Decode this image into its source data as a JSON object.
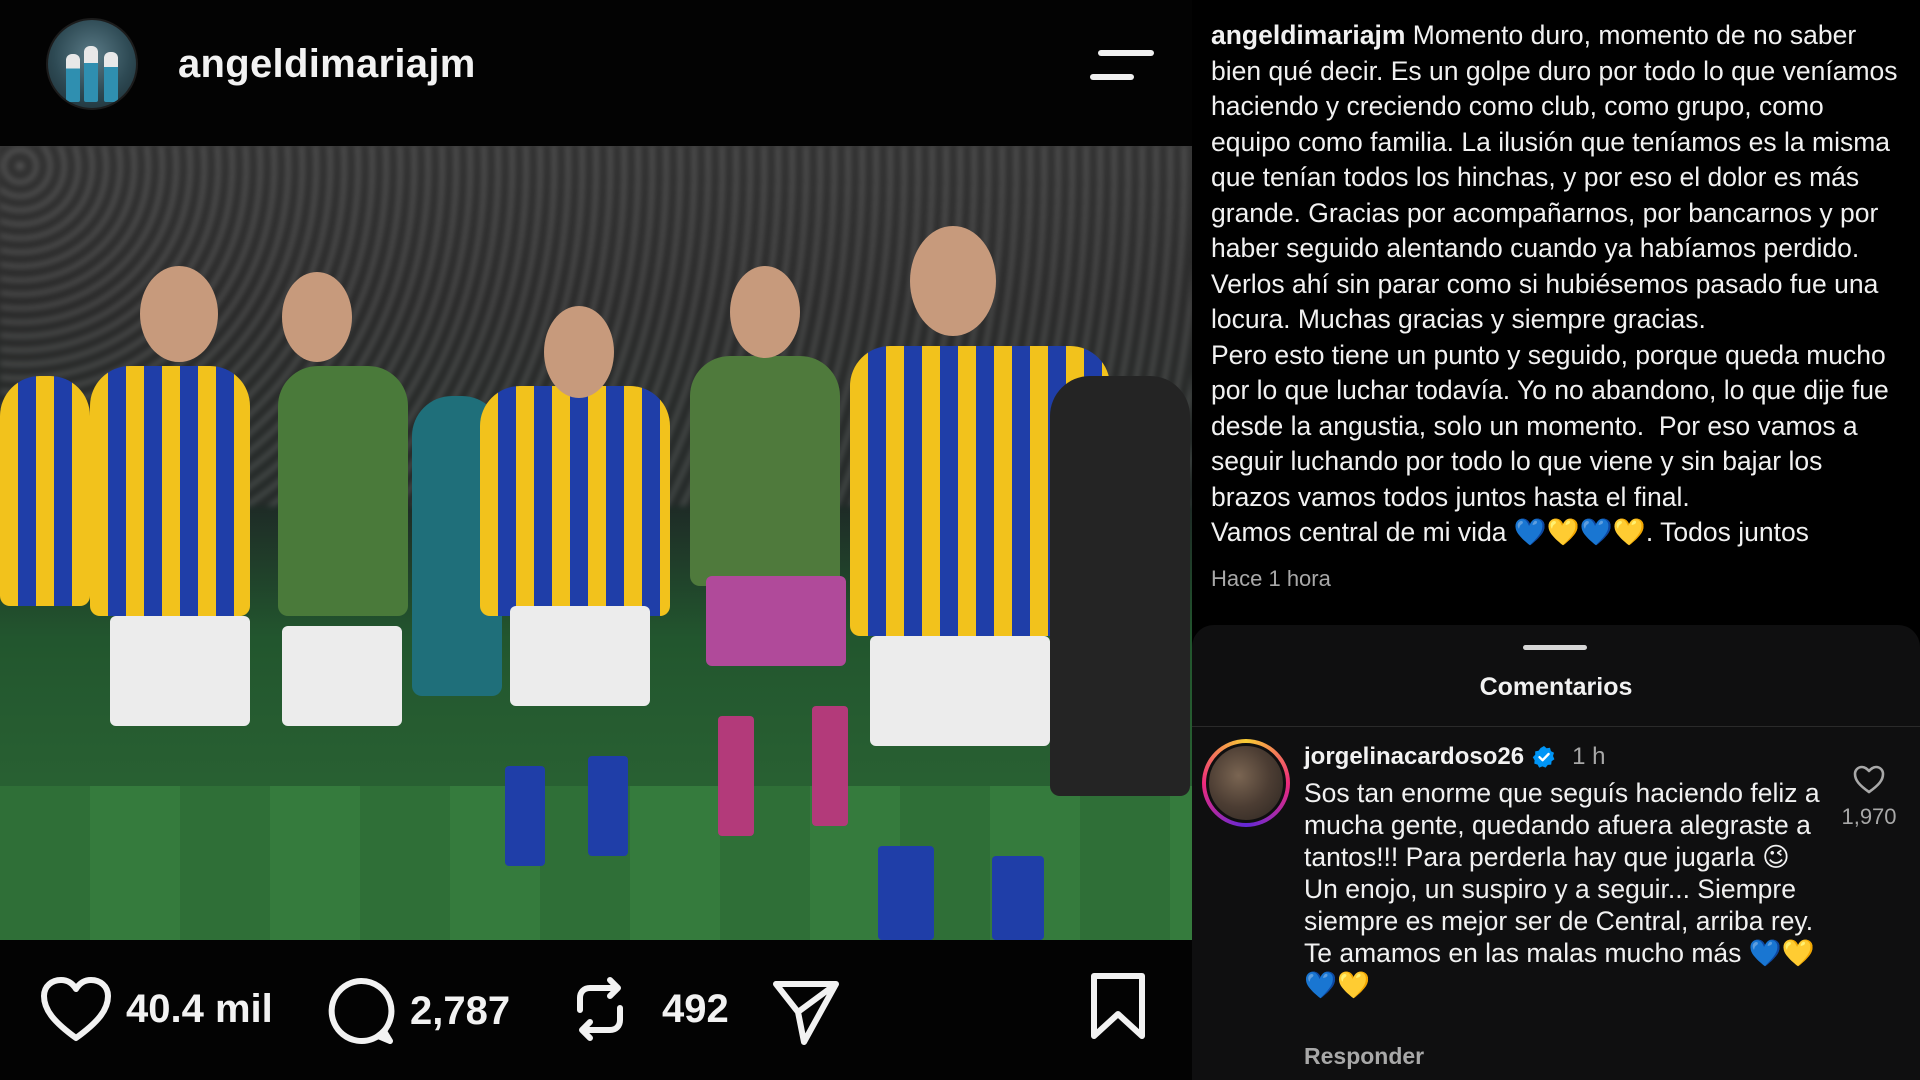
{
  "post": {
    "username": "angeldimariajm",
    "likes": "40.4 mil",
    "comments": "2,787",
    "reposts": "492"
  },
  "caption": {
    "username": "angeldimariajm",
    "text": " Momento duro, momento de no saber bien qué decir. Es un golpe duro por todo lo que veníamos haciendo y creciendo como club, como grupo, como equipo como familia. La ilusión que teníamos es la misma que tenían todos los hinchas, y por eso el dolor es más grande. Gracias por acompañarnos, por bancarnos y por haber seguido alentando cuando ya habíamos perdido. Verlos ahí sin parar como si hubiésemos pasado fue una locura. Muchas gracias y siempre gracias.\nPero esto tiene un punto y seguido, porque queda mucho por lo que luchar todavía. Yo no abandono, lo que dije fue desde la angustia, solo un momento.  Por eso vamos a seguir luchando por todo lo que viene y sin bajar los brazos vamos todos juntos hasta el final.\nVamos central de mi vida 💙💛💙💛. Todos juntos",
    "time": "Hace 1 hora"
  },
  "comments_panel": {
    "title": "Comentarios",
    "comment": {
      "username": "jorgelinacardoso26",
      "time": "1 h",
      "text": "Sos tan enorme que seguís haciendo feliz a mucha gente, quedando afuera alegraste a tantos!!! Para perderla hay que jugarla 😉\nUn enojo, un suspiro y a seguir... Siempre siempre es mejor ser de Central, arriba rey. Te amamos en las malas mucho más 💙💛💙💛",
      "likes": "1,970",
      "reply_label": "Responder"
    }
  },
  "colors": {
    "background": "#000000",
    "panel": "#0f0f10",
    "muted_text": "#a8a8a8",
    "verified_blue": "#0095f6",
    "kit_yellow": "#f2c21c",
    "kit_blue": "#1f3ea8"
  },
  "icons": [
    "menu-icon",
    "heart-icon",
    "comment-icon",
    "repost-icon",
    "share-icon",
    "bookmark-icon",
    "verified-icon",
    "comment-heart-icon"
  ]
}
